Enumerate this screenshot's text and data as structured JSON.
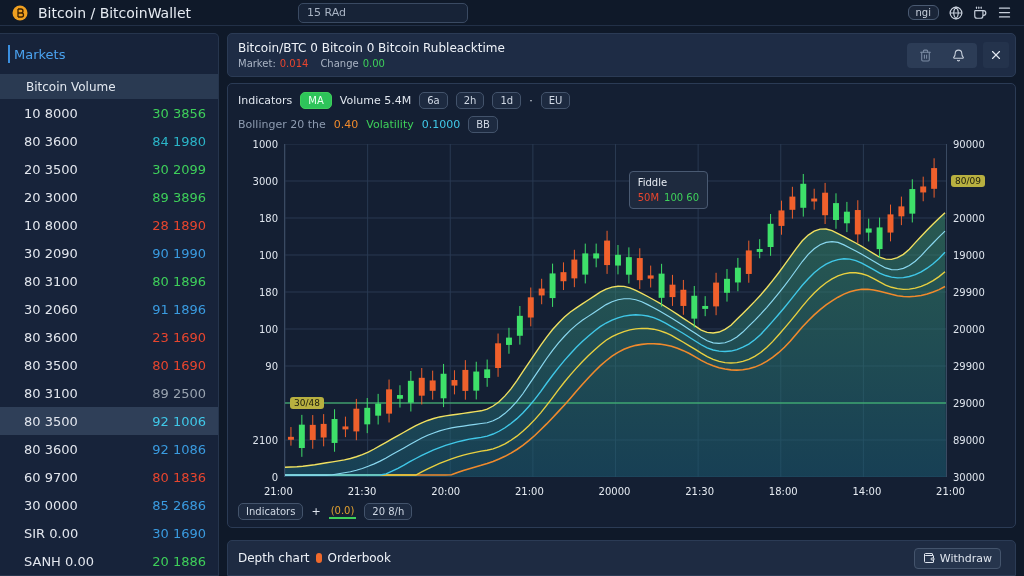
{
  "topbar": {
    "title": "Bitcoin / BitcoinWallet",
    "search": {
      "value": "15 RAd"
    },
    "pill": "ngi"
  },
  "sidebar": {
    "title": "Markets",
    "column_header": "Bitcoin Volume",
    "rows": [
      {
        "price": "10 8000",
        "change": "30 3856",
        "color": "#3ecf5a",
        "selected": false
      },
      {
        "price": "80 3600",
        "change": "84 1980",
        "color": "#2bb5c8",
        "selected": false
      },
      {
        "price": "20 3500",
        "change": "30 2099",
        "color": "#3ecf5a",
        "selected": false
      },
      {
        "price": "20 3000",
        "change": "89 3896",
        "color": "#3ecf5a",
        "selected": false
      },
      {
        "price": "10 8000",
        "change": "28 1890",
        "color": "#e8452e",
        "selected": false
      },
      {
        "price": "30 2090",
        "change": "90 1990",
        "color": "#3a9be0",
        "selected": false
      },
      {
        "price": "80 3100",
        "change": "80 1896",
        "color": "#3ecf5a",
        "selected": false
      },
      {
        "price": "30 2060",
        "change": "91 1896",
        "color": "#3a9be0",
        "selected": false
      },
      {
        "price": "80 3600",
        "change": "23 1690",
        "color": "#e8452e",
        "selected": false
      },
      {
        "price": "80 3500",
        "change": "80 1690",
        "color": "#e8452e",
        "selected": false
      },
      {
        "price": "80 3100",
        "change": "89 2500",
        "color": "#9aa4b0",
        "selected": false
      },
      {
        "price": "80 3500",
        "change": "92 1006",
        "color": "#40c8e8",
        "selected": true
      },
      {
        "price": "80 3600",
        "change": "92 1086",
        "color": "#3a9be0",
        "selected": false
      },
      {
        "price": "60 9700",
        "change": "80 1836",
        "color": "#e8452e",
        "selected": false
      },
      {
        "price": "30 0000",
        "change": "85 2686",
        "color": "#3a9be0",
        "selected": false
      },
      {
        "price": "SIR 0.00",
        "change": "30 1690",
        "color": "#3a9be0",
        "selected": false
      },
      {
        "price": "SANH 0.00",
        "change": "20 1886",
        "color": "#3ecf5a",
        "selected": false
      }
    ]
  },
  "header": {
    "title": "Bitcoin/BTC 0  Bitcoin 0  Bitcoin  Rubleacktime",
    "stats": [
      {
        "label": "Market:",
        "value": "0.014",
        "color": "#e8452e"
      },
      {
        "label": "Change",
        "value": "0.00",
        "color": "#3ecf5a"
      }
    ]
  },
  "toolbar": [
    {
      "kind": "text",
      "label": "Indicators"
    },
    {
      "kind": "chip",
      "label": "MA",
      "selected": true
    },
    {
      "kind": "text",
      "label": "Volume 5.4M"
    },
    {
      "kind": "chip",
      "label": "6a",
      "selected": false
    },
    {
      "kind": "chip",
      "label": "2h",
      "selected": false
    },
    {
      "kind": "chip",
      "label": "1d",
      "selected": false
    },
    {
      "kind": "text",
      "label": "·"
    },
    {
      "kind": "chip",
      "label": "EU",
      "selected": false
    }
  ],
  "indicators": [
    {
      "kind": "text",
      "label": "Bollinger 20 the",
      "color": "#8d9bb0"
    },
    {
      "kind": "text",
      "label": "0.40",
      "color": "#f08a2c"
    },
    {
      "kind": "text",
      "label": "Volatility",
      "color": "#3ecf5a"
    },
    {
      "kind": "text",
      "label": "0.1000",
      "color": "#40c8e8"
    },
    {
      "kind": "chip",
      "label": "BB"
    }
  ],
  "chart": {
    "left_axis": [
      {
        "kind": "tick",
        "text": "1000"
      },
      {
        "kind": "tick",
        "text": "3000"
      },
      {
        "kind": "tick",
        "text": "180"
      },
      {
        "kind": "tick",
        "text": "100"
      },
      {
        "kind": "tick",
        "text": "180"
      },
      {
        "kind": "tick",
        "text": "100"
      },
      {
        "kind": "tick",
        "text": "90"
      },
      {
        "kind": "badge",
        "text": "30/48"
      },
      {
        "kind": "tick",
        "text": "2100"
      },
      {
        "kind": "tick",
        "text": "0"
      }
    ],
    "right_axis": [
      {
        "kind": "tick",
        "text": "90000"
      },
      {
        "kind": "badge",
        "text": "80/09"
      },
      {
        "kind": "tick",
        "text": "20000"
      },
      {
        "kind": "tick",
        "text": "19000"
      },
      {
        "kind": "tick",
        "text": "29900"
      },
      {
        "kind": "tick",
        "text": "20000"
      },
      {
        "kind": "tick",
        "text": "29900"
      },
      {
        "kind": "tick",
        "text": "29000"
      },
      {
        "kind": "tick",
        "text": "89000"
      },
      {
        "kind": "tick",
        "text": "30000"
      }
    ],
    "x_axis": [
      "21:00",
      "21:30",
      "20:00",
      "21:00",
      "20000",
      "21:30",
      "18:00",
      "14:00",
      "21:00"
    ],
    "tooltip": {
      "title": "Fiddle",
      "values": [
        {
          "text": "50M",
          "color": "#e8452e"
        },
        {
          "text": "100 60",
          "color": "#3ecf5a"
        }
      ]
    }
  },
  "legend": [
    {
      "kind": "chip",
      "label": "Indicators"
    },
    {
      "kind": "text",
      "label": "+"
    },
    {
      "kind": "active",
      "label": "(0.0)"
    },
    {
      "kind": "chip",
      "label": "20 8/h"
    }
  ],
  "footer": {
    "title": "Depth chart",
    "subtitle": "Orderbook",
    "button": "Withdraw"
  }
}
